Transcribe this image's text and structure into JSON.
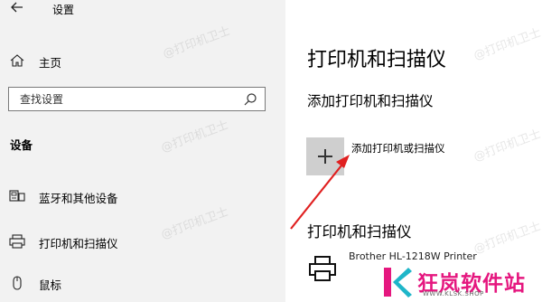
{
  "app": {
    "title": "设置"
  },
  "sidebar": {
    "home_label": "主页",
    "search_placeholder": "查找设置",
    "section_title": "设备",
    "items": [
      {
        "label": "蓝牙和其他设备",
        "icon": "bluetooth-devices-icon"
      },
      {
        "label": "打印机和扫描仪",
        "icon": "printer-icon"
      },
      {
        "label": "鼠标",
        "icon": "mouse-icon"
      }
    ]
  },
  "main": {
    "title": "打印机和扫描仪",
    "add_section_title": "添加打印机和扫描仪",
    "add_button_label": "添加打印机或扫描仪",
    "list_title": "打印机和扫描仪",
    "printers": [
      {
        "name": "Brother HL-1218W Printer"
      }
    ]
  },
  "watermark": {
    "text": "@打印机卫士"
  },
  "logo": {
    "text": "狂岚软件站",
    "url": "WWW.KLSK.SHOP",
    "colors": {
      "k_left": "#e5177f",
      "k_right": "#1fb6c9",
      "text": "#e5177f"
    }
  },
  "annotation": {
    "arrow_color": "#e02020"
  }
}
